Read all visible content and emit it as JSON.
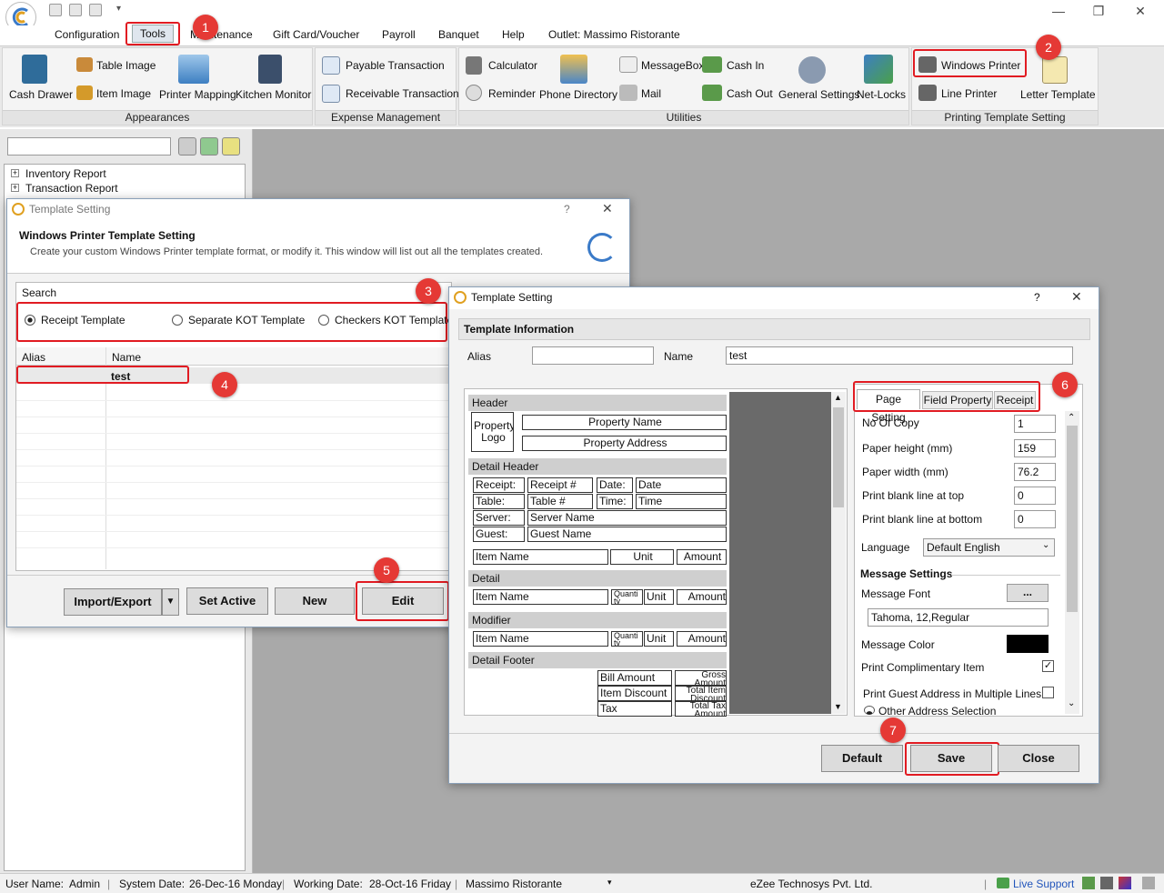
{
  "menu": {
    "configuration": "Configuration",
    "tools": "Tools",
    "maintenance": "Maintenance",
    "giftcard": "Gift Card/Voucher",
    "payroll": "Payroll",
    "banquet": "Banquet",
    "help": "Help",
    "outlet": "Outlet: Massimo Ristorante"
  },
  "ribbon": {
    "appearances": {
      "label": "Appearances",
      "cash_drawer": "Cash Drawer",
      "table_image": "Table Image",
      "item_image": "Item Image",
      "printer_mapping": "Printer Mapping",
      "kitchen_monitor": "Kitchen Monitor"
    },
    "expense": {
      "label": "Expense Management",
      "payable": "Payable Transaction",
      "receivable": "Receivable Transaction"
    },
    "utilities": {
      "label": "Utilities",
      "calculator": "Calculator",
      "reminder": "Reminder",
      "phone_directory": "Phone Directory",
      "messagebox": "MessageBox",
      "mail": "Mail",
      "cash_in": "Cash In",
      "cash_out": "Cash Out",
      "general_settings": "General Settings",
      "netlocks": "Net-Locks"
    },
    "printing": {
      "label": "Printing Template Setting",
      "windows_printer": "Windows Printer",
      "line_printer": "Line Printer",
      "letter_template": "Letter Template"
    }
  },
  "tree": [
    "Inventory Report",
    "Transaction Report"
  ],
  "dialog1": {
    "title": "Template Setting",
    "help": "?",
    "heading": "Windows Printer Template Setting",
    "subheading": "Create your custom Windows Printer template format, or modify it. This window will list out all the templates created.",
    "search_label": "Search",
    "radio_receipt": "Receipt Template",
    "radio_separate_kot": "Separate KOT Template",
    "radio_checkers_kot": "Checkers KOT Template",
    "col_alias": "Alias",
    "col_name": "Name",
    "rows": [
      {
        "alias": "",
        "name": "test"
      }
    ],
    "btn_import": "Import/Export",
    "btn_set_active": "Set Active",
    "btn_new": "New",
    "btn_edit": "Edit"
  },
  "dialog2": {
    "title": "Template Setting",
    "help": "?",
    "section": "Template Information",
    "alias_label": "Alias",
    "alias_value": "",
    "name_label": "Name",
    "name_value": "test",
    "preview": {
      "header": "Header",
      "property_logo": "Property Logo",
      "property_name": "Property Name",
      "property_address": "Property Address",
      "detail_header": "Detail Header",
      "receipt": "Receipt:",
      "receipt_no": "Receipt #",
      "date": "Date:",
      "date_v": "Date",
      "table": "Table:",
      "table_no": "Table #",
      "time": "Time:",
      "time_v": "Time",
      "server": "Server:",
      "server_name": "Server Name",
      "guest": "Guest:",
      "guest_name": "Guest Name",
      "item_name": "Item Name",
      "unit": "Unit",
      "amount": "Amount",
      "detail": "Detail",
      "quantity": "Quanti ty",
      "modifier": "Modifier",
      "detail_footer": "Detail Footer",
      "bill_amount": "Bill Amount",
      "item_discount": "Item Discount",
      "tax": "Tax",
      "gross_amount": "Gross Amount",
      "total_item_discount": "Total Item Discount",
      "total_tax_amount": "Total Tax Amount"
    },
    "tabs": {
      "page_setting": "Page Setting",
      "field_property": "Field Property",
      "receipt": "Receipt"
    },
    "props": {
      "no_of_copy": "No Of Copy",
      "no_of_copy_v": "1",
      "paper_height": "Paper height (mm)",
      "paper_height_v": "159",
      "paper_width": "Paper width (mm)",
      "paper_width_v": "76.2",
      "blank_top": "Print blank line at top",
      "blank_top_v": "0",
      "blank_bottom": "Print blank line at bottom",
      "blank_bottom_v": "0",
      "language": "Language",
      "language_v": "Default English",
      "message_settings": "Message Settings",
      "message_font": "Message Font",
      "font_btn": "...",
      "font_value": "Tahoma, 12,Regular",
      "message_color": "Message Color",
      "print_complimentary": "Print Complimentary Item",
      "print_guest_address": "Print Guest Address in Multiple Lines",
      "other_address": "Other Address Selection"
    },
    "btn_default": "Default",
    "btn_save": "Save",
    "btn_close": "Close"
  },
  "badges": [
    "1",
    "2",
    "3",
    "4",
    "5",
    "6",
    "7"
  ],
  "status": {
    "user_label": "User Name:",
    "user": "Admin",
    "sysdate_label": "System Date:",
    "sysdate": "26-Dec-16 Monday",
    "workdate_label": "Working Date:",
    "workdate": "28-Oct-16 Friday",
    "outlet": "Massimo Ristorante",
    "company": "eZee Technosys Pvt. Ltd.",
    "live_support": "Live Support"
  }
}
